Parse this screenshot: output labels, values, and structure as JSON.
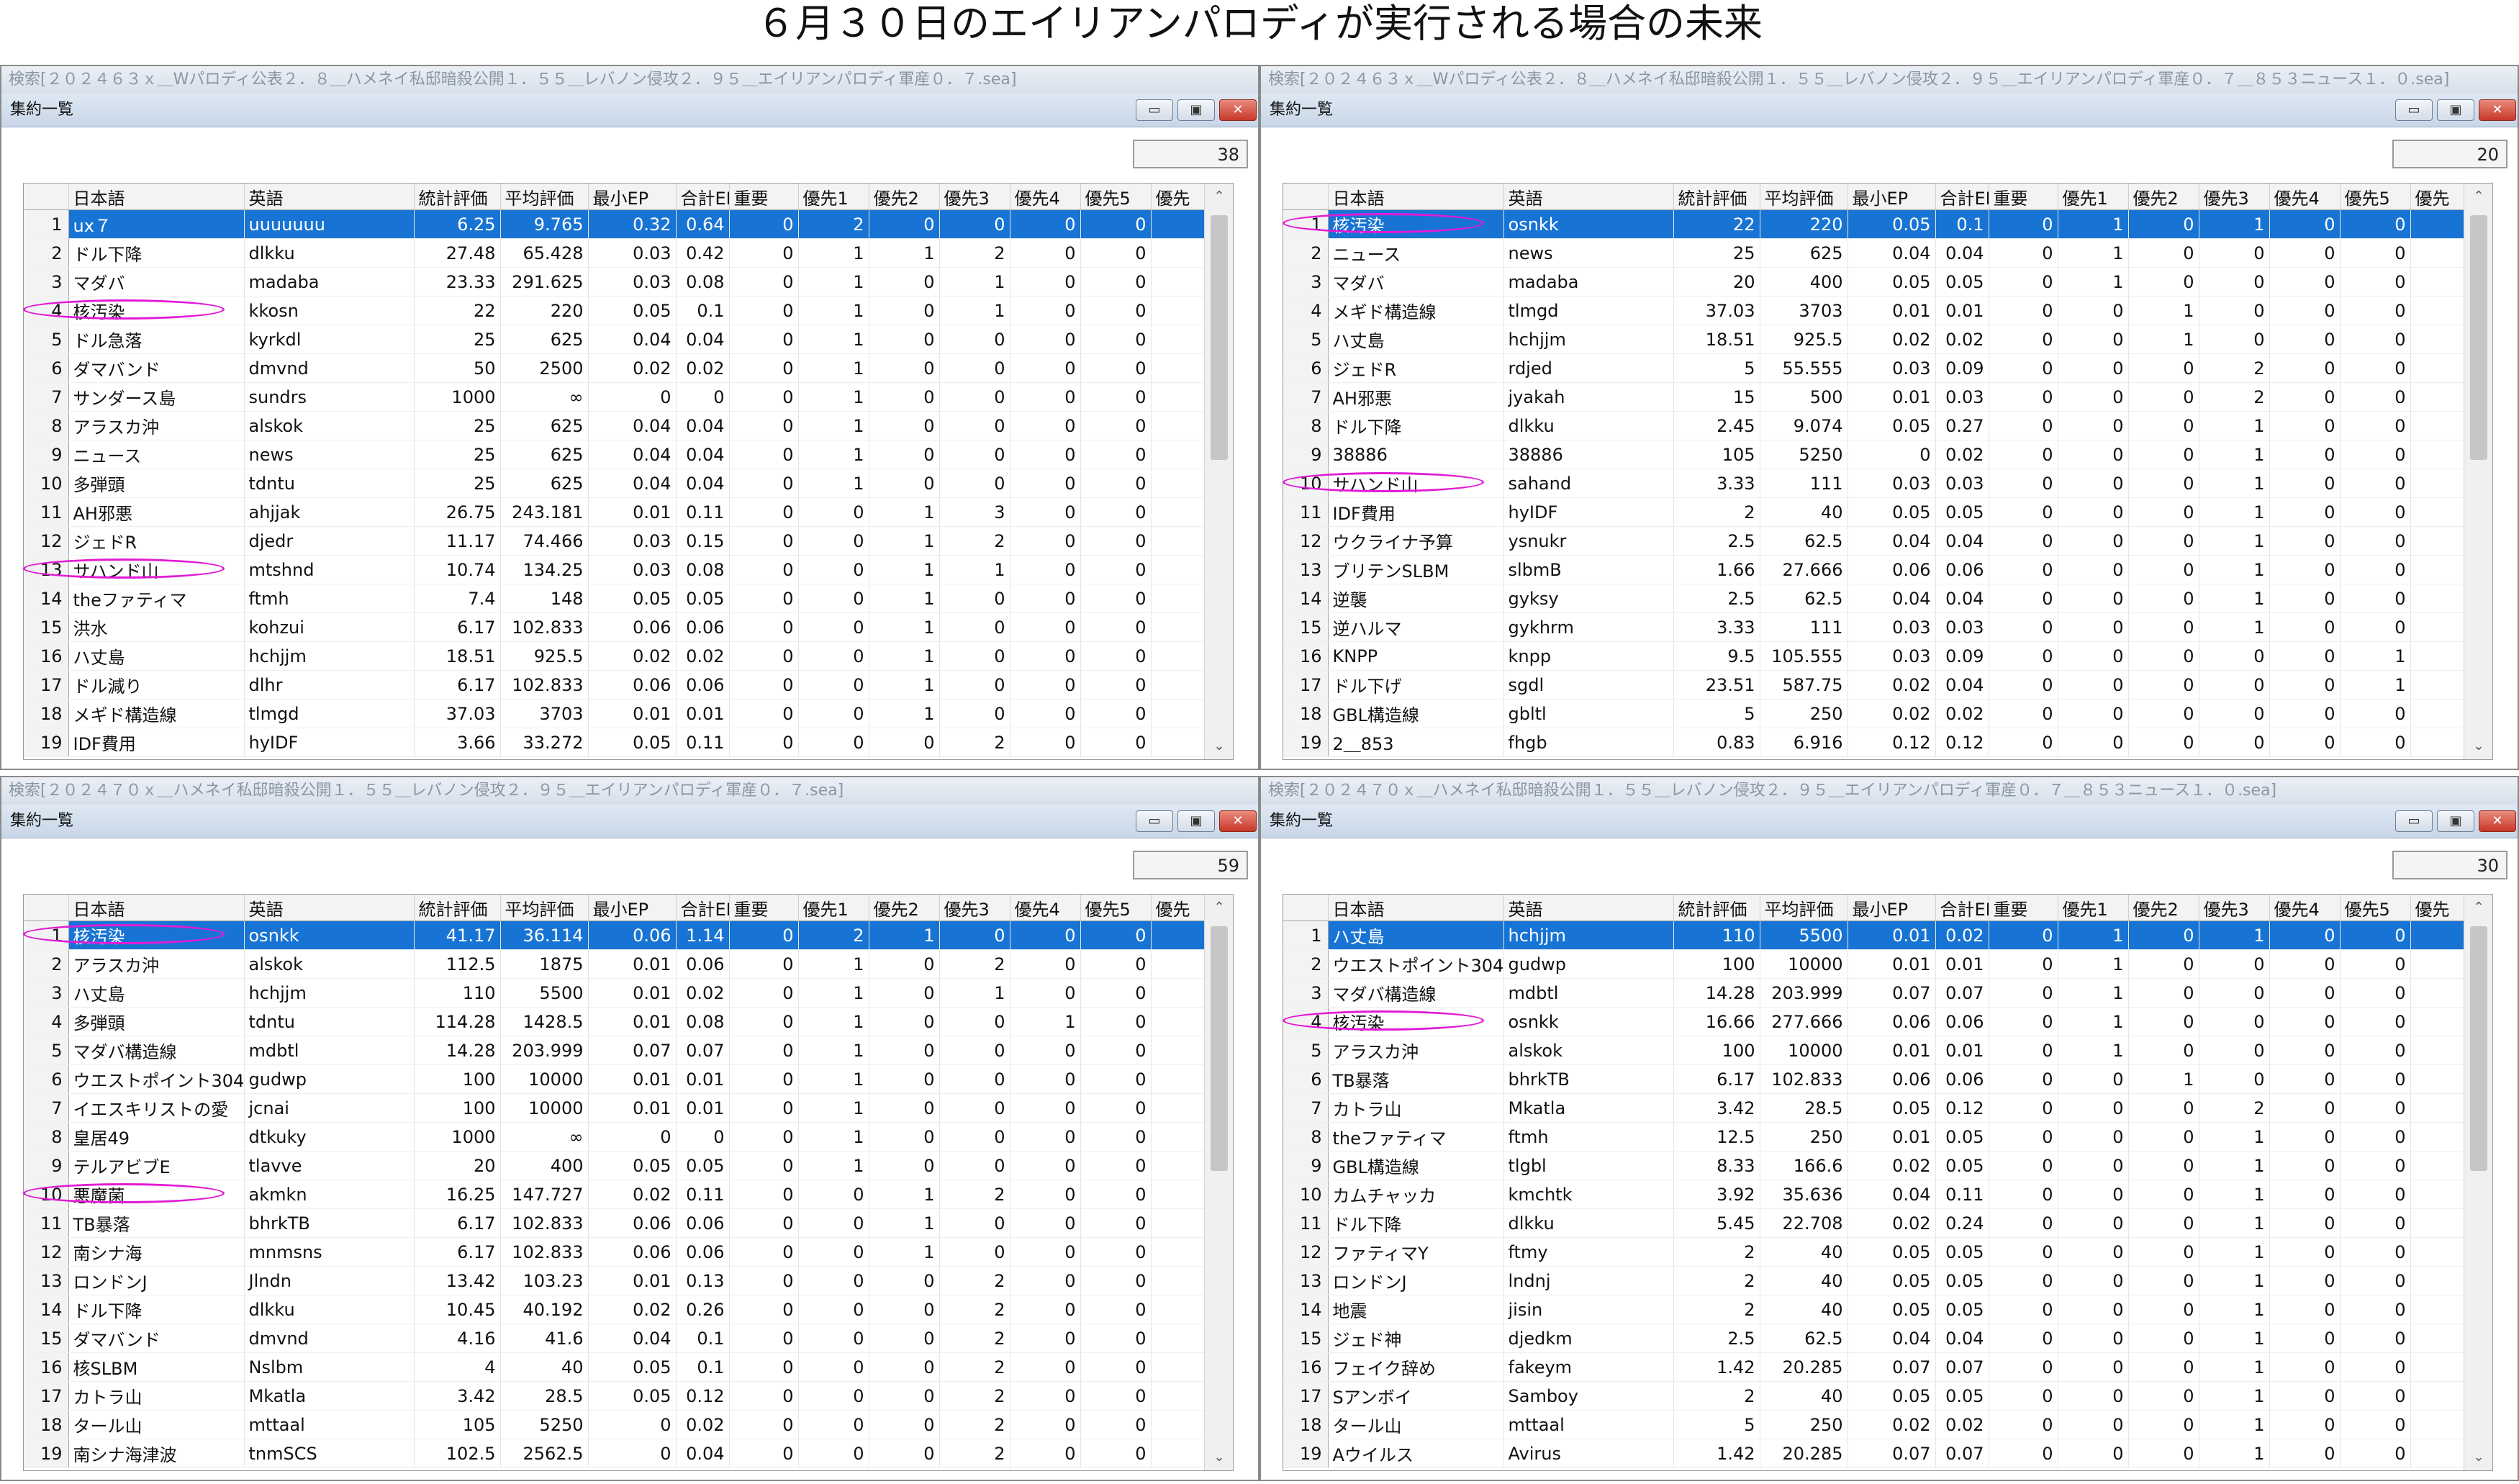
{
  "page_title": "６月３０日のエイリアンパロディが実行される場合の未来",
  "window_title": "集約一覧",
  "window_buttons": {
    "minimize": "▭",
    "restore": "▣",
    "close": "✕"
  },
  "columns": [
    "日本語",
    "英語",
    "統計評価",
    "平均評価",
    "最小EP",
    "合計EP",
    "重要",
    "優先1",
    "優先2",
    "優先3",
    "優先4",
    "優先5",
    "優先"
  ],
  "icons": {
    "scroll_up": "chevron-up-icon",
    "scroll_down": "chevron-down-icon",
    "annotation": "ellipse-marker"
  },
  "colors": {
    "selection": "#1874d4",
    "annotation": "#e21ad6",
    "title_bar": "#c7d6e8"
  },
  "scroll_up_glyph": "⌃",
  "scroll_down_glyph": "⌄",
  "panels": [
    {
      "search": "検索[２０２４６３ｘ＿Wパロディ公表２．８＿ハメネイ私邸暗殺公開１．５５＿レバノン侵攻２．９５＿エイリアンパロディ軍産０．７.sea]",
      "count": "38",
      "rows": [
        [
          "1",
          "ux７",
          "uuuuuuu",
          "6.25",
          "9.765",
          "0.32",
          "0.64",
          "0",
          "2",
          "0",
          "0",
          "0",
          "0"
        ],
        [
          "2",
          "ドル下降",
          "dlkku",
          "27.48",
          "65.428",
          "0.03",
          "0.42",
          "0",
          "1",
          "1",
          "2",
          "0",
          "0"
        ],
        [
          "3",
          "マダバ",
          "madaba",
          "23.33",
          "291.625",
          "0.03",
          "0.08",
          "0",
          "1",
          "0",
          "1",
          "0",
          "0"
        ],
        [
          "4",
          "核汚染",
          "kkosn",
          "22",
          "220",
          "0.05",
          "0.1",
          "0",
          "1",
          "0",
          "1",
          "0",
          "0"
        ],
        [
          "5",
          "ドル急落",
          "kyrkdl",
          "25",
          "625",
          "0.04",
          "0.04",
          "0",
          "1",
          "0",
          "0",
          "0",
          "0"
        ],
        [
          "6",
          "ダマバンド",
          "dmvnd",
          "50",
          "2500",
          "0.02",
          "0.02",
          "0",
          "1",
          "0",
          "0",
          "0",
          "0"
        ],
        [
          "7",
          "サンダース島",
          "sundrs",
          "1000",
          "∞",
          "0",
          "0",
          "0",
          "1",
          "0",
          "0",
          "0",
          "0"
        ],
        [
          "8",
          "アラスカ沖",
          "alskok",
          "25",
          "625",
          "0.04",
          "0.04",
          "0",
          "1",
          "0",
          "0",
          "0",
          "0"
        ],
        [
          "9",
          "ニュース",
          "news",
          "25",
          "625",
          "0.04",
          "0.04",
          "0",
          "1",
          "0",
          "0",
          "0",
          "0"
        ],
        [
          "10",
          "多弾頭",
          "tdntu",
          "25",
          "625",
          "0.04",
          "0.04",
          "0",
          "1",
          "0",
          "0",
          "0",
          "0"
        ],
        [
          "11",
          "AH邪悪",
          "ahjjak",
          "26.75",
          "243.181",
          "0.01",
          "0.11",
          "0",
          "0",
          "1",
          "3",
          "0",
          "0"
        ],
        [
          "12",
          "ジェドR",
          "djedr",
          "11.17",
          "74.466",
          "0.03",
          "0.15",
          "0",
          "0",
          "1",
          "2",
          "0",
          "0"
        ],
        [
          "13",
          "サハンド山",
          "mtshnd",
          "10.74",
          "134.25",
          "0.03",
          "0.08",
          "0",
          "0",
          "1",
          "1",
          "0",
          "0"
        ],
        [
          "14",
          "theファティマ",
          "ftmh",
          "7.4",
          "148",
          "0.05",
          "0.05",
          "0",
          "0",
          "1",
          "0",
          "0",
          "0"
        ],
        [
          "15",
          "洪水",
          "kohzui",
          "6.17",
          "102.833",
          "0.06",
          "0.06",
          "0",
          "0",
          "1",
          "0",
          "0",
          "0"
        ],
        [
          "16",
          "ハ丈島",
          "hchjjm",
          "18.51",
          "925.5",
          "0.02",
          "0.02",
          "0",
          "0",
          "1",
          "0",
          "0",
          "0"
        ],
        [
          "17",
          "ドル減り",
          "dlhr",
          "6.17",
          "102.833",
          "0.06",
          "0.06",
          "0",
          "0",
          "1",
          "0",
          "0",
          "0"
        ],
        [
          "18",
          "メギド構造線",
          "tlmgd",
          "37.03",
          "3703",
          "0.01",
          "0.01",
          "0",
          "0",
          "1",
          "0",
          "0",
          "0"
        ],
        [
          "19",
          "IDF費用",
          "hyIDF",
          "3.66",
          "33.272",
          "0.05",
          "0.11",
          "0",
          "0",
          "0",
          "2",
          "0",
          "0"
        ]
      ]
    },
    {
      "search": "検索[２０２４６３ｘ＿Wパロディ公表２．８＿ハメネイ私邸暗殺公開１．５５＿レバノン侵攻２．９５＿エイリアンパロディ軍産０．７＿８５３ニュース１．０.sea]",
      "count": "20",
      "rows": [
        [
          "1",
          "核汚染",
          "osnkk",
          "22",
          "220",
          "0.05",
          "0.1",
          "0",
          "1",
          "0",
          "1",
          "0",
          "0"
        ],
        [
          "2",
          "ニュース",
          "news",
          "25",
          "625",
          "0.04",
          "0.04",
          "0",
          "1",
          "0",
          "0",
          "0",
          "0"
        ],
        [
          "3",
          "マダバ",
          "madaba",
          "20",
          "400",
          "0.05",
          "0.05",
          "0",
          "1",
          "0",
          "0",
          "0",
          "0"
        ],
        [
          "4",
          "メギド構造線",
          "tlmgd",
          "37.03",
          "3703",
          "0.01",
          "0.01",
          "0",
          "0",
          "1",
          "0",
          "0",
          "0"
        ],
        [
          "5",
          "ハ丈島",
          "hchjjm",
          "18.51",
          "925.5",
          "0.02",
          "0.02",
          "0",
          "0",
          "1",
          "0",
          "0",
          "0"
        ],
        [
          "6",
          "ジェドR",
          "rdjed",
          "5",
          "55.555",
          "0.03",
          "0.09",
          "0",
          "0",
          "0",
          "2",
          "0",
          "0"
        ],
        [
          "7",
          "AH邪悪",
          "jyakah",
          "15",
          "500",
          "0.01",
          "0.03",
          "0",
          "0",
          "0",
          "2",
          "0",
          "0"
        ],
        [
          "8",
          "ドル下降",
          "dlkku",
          "2.45",
          "9.074",
          "0.05",
          "0.27",
          "0",
          "0",
          "0",
          "1",
          "0",
          "0"
        ],
        [
          "9",
          "38886",
          "38886",
          "105",
          "5250",
          "0",
          "0.02",
          "0",
          "0",
          "0",
          "1",
          "0",
          "0"
        ],
        [
          "10",
          "サハンド山",
          "sahand",
          "3.33",
          "111",
          "0.03",
          "0.03",
          "0",
          "0",
          "0",
          "1",
          "0",
          "0"
        ],
        [
          "11",
          "IDF費用",
          "hyIDF",
          "2",
          "40",
          "0.05",
          "0.05",
          "0",
          "0",
          "0",
          "1",
          "0",
          "0"
        ],
        [
          "12",
          "ウクライナ予算",
          "ysnukr",
          "2.5",
          "62.5",
          "0.04",
          "0.04",
          "0",
          "0",
          "0",
          "1",
          "0",
          "0"
        ],
        [
          "13",
          "ブリテンSLBM",
          "slbmB",
          "1.66",
          "27.666",
          "0.06",
          "0.06",
          "0",
          "0",
          "0",
          "1",
          "0",
          "0"
        ],
        [
          "14",
          "逆襲",
          "gyksy",
          "2.5",
          "62.5",
          "0.04",
          "0.04",
          "0",
          "0",
          "0",
          "1",
          "0",
          "0"
        ],
        [
          "15",
          "逆ハルマ",
          "gykhrm",
          "3.33",
          "111",
          "0.03",
          "0.03",
          "0",
          "0",
          "0",
          "1",
          "0",
          "0"
        ],
        [
          "16",
          "KNPP",
          "knpp",
          "9.5",
          "105.555",
          "0.03",
          "0.09",
          "0",
          "0",
          "0",
          "0",
          "0",
          "1"
        ],
        [
          "17",
          "ドル下げ",
          "sgdl",
          "23.51",
          "587.75",
          "0.02",
          "0.04",
          "0",
          "0",
          "0",
          "0",
          "0",
          "1"
        ],
        [
          "18",
          "GBL構造線",
          "gbltl",
          "5",
          "250",
          "0.02",
          "0.02",
          "0",
          "0",
          "0",
          "0",
          "0",
          "0"
        ],
        [
          "19",
          "2＿853",
          "fhgb",
          "0.83",
          "6.916",
          "0.12",
          "0.12",
          "0",
          "0",
          "0",
          "0",
          "0",
          "0"
        ]
      ]
    },
    {
      "search": "検索[２０２４７０ｘ＿ハメネイ私邸暗殺公開１．５５＿レバノン侵攻２．９５＿エイリアンパロディ軍産０．７.sea]",
      "count": "59",
      "rows": [
        [
          "1",
          "核汚染",
          "osnkk",
          "41.17",
          "36.114",
          "0.06",
          "1.14",
          "0",
          "2",
          "1",
          "0",
          "0",
          "0"
        ],
        [
          "2",
          "アラスカ沖",
          "alskok",
          "112.5",
          "1875",
          "0.01",
          "0.06",
          "0",
          "1",
          "0",
          "2",
          "0",
          "0"
        ],
        [
          "3",
          "ハ丈島",
          "hchjjm",
          "110",
          "5500",
          "0.01",
          "0.02",
          "0",
          "1",
          "0",
          "1",
          "0",
          "0"
        ],
        [
          "4",
          "多弾頭",
          "tdntu",
          "114.28",
          "1428.5",
          "0.01",
          "0.08",
          "0",
          "1",
          "0",
          "0",
          "1",
          "0"
        ],
        [
          "5",
          "マダバ構造線",
          "mdbtl",
          "14.28",
          "203.999",
          "0.07",
          "0.07",
          "0",
          "1",
          "0",
          "0",
          "0",
          "0"
        ],
        [
          "6",
          "ウエストポイント304",
          "gudwp",
          "100",
          "10000",
          "0.01",
          "0.01",
          "0",
          "1",
          "0",
          "0",
          "0",
          "0"
        ],
        [
          "7",
          "イエスキリストの愛",
          "jcnai",
          "100",
          "10000",
          "0.01",
          "0.01",
          "0",
          "1",
          "0",
          "0",
          "0",
          "0"
        ],
        [
          "8",
          "皇居49",
          "dtkuky",
          "1000",
          "∞",
          "0",
          "0",
          "0",
          "1",
          "0",
          "0",
          "0",
          "0"
        ],
        [
          "9",
          "テルアビブE",
          "tlavve",
          "20",
          "400",
          "0.05",
          "0.05",
          "0",
          "1",
          "0",
          "0",
          "0",
          "0"
        ],
        [
          "10",
          "悪魔菌",
          "akmkn",
          "16.25",
          "147.727",
          "0.02",
          "0.11",
          "0",
          "0",
          "1",
          "2",
          "0",
          "0"
        ],
        [
          "11",
          "TB暴落",
          "bhrkTB",
          "6.17",
          "102.833",
          "0.06",
          "0.06",
          "0",
          "0",
          "1",
          "0",
          "0",
          "0"
        ],
        [
          "12",
          "南シナ海",
          "mnmsns",
          "6.17",
          "102.833",
          "0.06",
          "0.06",
          "0",
          "0",
          "1",
          "0",
          "0",
          "0"
        ],
        [
          "13",
          "ロンドンJ",
          "Jlndn",
          "13.42",
          "103.23",
          "0.01",
          "0.13",
          "0",
          "0",
          "0",
          "2",
          "0",
          "0"
        ],
        [
          "14",
          "ドル下降",
          "dlkku",
          "10.45",
          "40.192",
          "0.02",
          "0.26",
          "0",
          "0",
          "0",
          "2",
          "0",
          "0"
        ],
        [
          "15",
          "ダマバンド",
          "dmvnd",
          "4.16",
          "41.6",
          "0.04",
          "0.1",
          "0",
          "0",
          "0",
          "2",
          "0",
          "0"
        ],
        [
          "16",
          "核SLBM",
          "Nslbm",
          "4",
          "40",
          "0.05",
          "0.1",
          "0",
          "0",
          "0",
          "2",
          "0",
          "0"
        ],
        [
          "17",
          "カトラ山",
          "Mkatla",
          "3.42",
          "28.5",
          "0.05",
          "0.12",
          "0",
          "0",
          "0",
          "2",
          "0",
          "0"
        ],
        [
          "18",
          "タール山",
          "mttaal",
          "105",
          "5250",
          "0",
          "0.02",
          "0",
          "0",
          "0",
          "2",
          "0",
          "0"
        ],
        [
          "19",
          "南シナ海津波",
          "tnmSCS",
          "102.5",
          "2562.5",
          "0",
          "0.04",
          "0",
          "0",
          "0",
          "2",
          "0",
          "0"
        ]
      ]
    },
    {
      "search": "検索[２０２４７０ｘ＿ハメネイ私邸暗殺公開１．５５＿レバノン侵攻２．９５＿エイリアンパロディ軍産０．７＿８５３ニュース１．０.sea]",
      "count": "30",
      "rows": [
        [
          "1",
          "ハ丈島",
          "hchjjm",
          "110",
          "5500",
          "0.01",
          "0.02",
          "0",
          "1",
          "0",
          "1",
          "0",
          "0"
        ],
        [
          "2",
          "ウエストポイント304",
          "gudwp",
          "100",
          "10000",
          "0.01",
          "0.01",
          "0",
          "1",
          "0",
          "0",
          "0",
          "0"
        ],
        [
          "3",
          "マダバ構造線",
          "mdbtl",
          "14.28",
          "203.999",
          "0.07",
          "0.07",
          "0",
          "1",
          "0",
          "0",
          "0",
          "0"
        ],
        [
          "4",
          "核汚染",
          "osnkk",
          "16.66",
          "277.666",
          "0.06",
          "0.06",
          "0",
          "1",
          "0",
          "0",
          "0",
          "0"
        ],
        [
          "5",
          "アラスカ沖",
          "alskok",
          "100",
          "10000",
          "0.01",
          "0.01",
          "0",
          "1",
          "0",
          "0",
          "0",
          "0"
        ],
        [
          "6",
          "TB暴落",
          "bhrkTB",
          "6.17",
          "102.833",
          "0.06",
          "0.06",
          "0",
          "0",
          "1",
          "0",
          "0",
          "0"
        ],
        [
          "7",
          "カトラ山",
          "Mkatla",
          "3.42",
          "28.5",
          "0.05",
          "0.12",
          "0",
          "0",
          "0",
          "2",
          "0",
          "0"
        ],
        [
          "8",
          "theファティマ",
          "ftmh",
          "12.5",
          "250",
          "0.01",
          "0.05",
          "0",
          "0",
          "0",
          "1",
          "0",
          "0"
        ],
        [
          "9",
          "GBL構造線",
          "tlgbl",
          "8.33",
          "166.6",
          "0.02",
          "0.05",
          "0",
          "0",
          "0",
          "1",
          "0",
          "0"
        ],
        [
          "10",
          "カムチャッカ",
          "kmchtk",
          "3.92",
          "35.636",
          "0.04",
          "0.11",
          "0",
          "0",
          "0",
          "1",
          "0",
          "0"
        ],
        [
          "11",
          "ドル下降",
          "dlkku",
          "5.45",
          "22.708",
          "0.02",
          "0.24",
          "0",
          "0",
          "0",
          "1",
          "0",
          "0"
        ],
        [
          "12",
          "ファティマY",
          "ftmy",
          "2",
          "40",
          "0.05",
          "0.05",
          "0",
          "0",
          "0",
          "1",
          "0",
          "0"
        ],
        [
          "13",
          "ロンドンJ",
          "lndnj",
          "2",
          "40",
          "0.05",
          "0.05",
          "0",
          "0",
          "0",
          "1",
          "0",
          "0"
        ],
        [
          "14",
          "地震",
          "jisin",
          "2",
          "40",
          "0.05",
          "0.05",
          "0",
          "0",
          "0",
          "1",
          "0",
          "0"
        ],
        [
          "15",
          "ジェド神",
          "djedkm",
          "2.5",
          "62.5",
          "0.04",
          "0.04",
          "0",
          "0",
          "0",
          "1",
          "0",
          "0"
        ],
        [
          "16",
          "フェイク辞め",
          "fakeym",
          "1.42",
          "20.285",
          "0.07",
          "0.07",
          "0",
          "0",
          "0",
          "1",
          "0",
          "0"
        ],
        [
          "17",
          "Sアンボイ",
          "Samboy",
          "2",
          "40",
          "0.05",
          "0.05",
          "0",
          "0",
          "0",
          "1",
          "0",
          "0"
        ],
        [
          "18",
          "タール山",
          "mttaal",
          "5",
          "250",
          "0.02",
          "0.02",
          "0",
          "0",
          "0",
          "1",
          "0",
          "0"
        ],
        [
          "19",
          "Aウイルス",
          "Avirus",
          "1.42",
          "20.285",
          "0.07",
          "0.07",
          "0",
          "0",
          "0",
          "1",
          "0",
          "0"
        ]
      ]
    }
  ]
}
